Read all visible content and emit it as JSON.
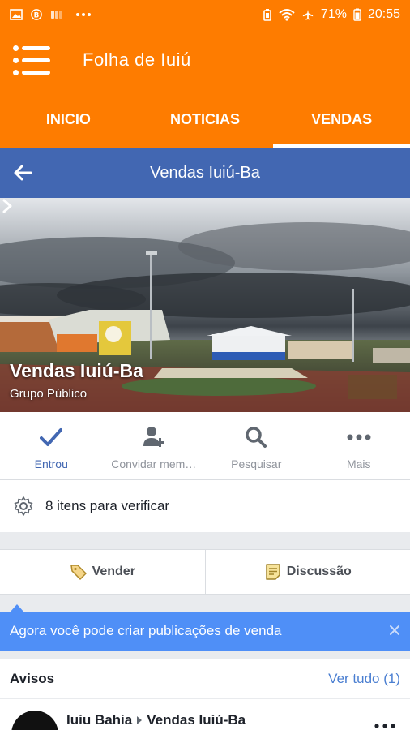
{
  "status_bar": {
    "battery": "71%",
    "time": "20:55"
  },
  "app": {
    "title": "Folha de Iuiú"
  },
  "tabs": [
    {
      "label": "INICIO",
      "active": false
    },
    {
      "label": "NOTICIAS",
      "active": false
    },
    {
      "label": "VENDAS",
      "active": true
    }
  ],
  "group_header": {
    "title": "Vendas Iuiú-Ba"
  },
  "cover": {
    "name": "Vendas Iuiú-Ba",
    "type": "Grupo Público"
  },
  "actions": [
    {
      "label": "Entrou",
      "icon": "check-icon"
    },
    {
      "label": "Convidar mem…",
      "icon": "add-member-icon"
    },
    {
      "label": "Pesquisar",
      "icon": "search-icon"
    },
    {
      "label": "Mais",
      "icon": "more-icon"
    }
  ],
  "verify": {
    "text": "8 itens para verificar"
  },
  "sell_buttons": {
    "sell": "Vender",
    "discussion": "Discussão"
  },
  "tip": {
    "text": "Agora você pode criar publicações de venda"
  },
  "notices": {
    "label": "Avisos",
    "see_all": "Ver tudo (1)"
  },
  "post": {
    "author": "Iuiu Bahia",
    "group": "Vendas Iuiú-Ba"
  },
  "colors": {
    "orange": "#fe7c00",
    "facebook_blue": "#4267b2",
    "tip_blue": "#4f8ff7",
    "link_blue": "#4b7fd1"
  }
}
